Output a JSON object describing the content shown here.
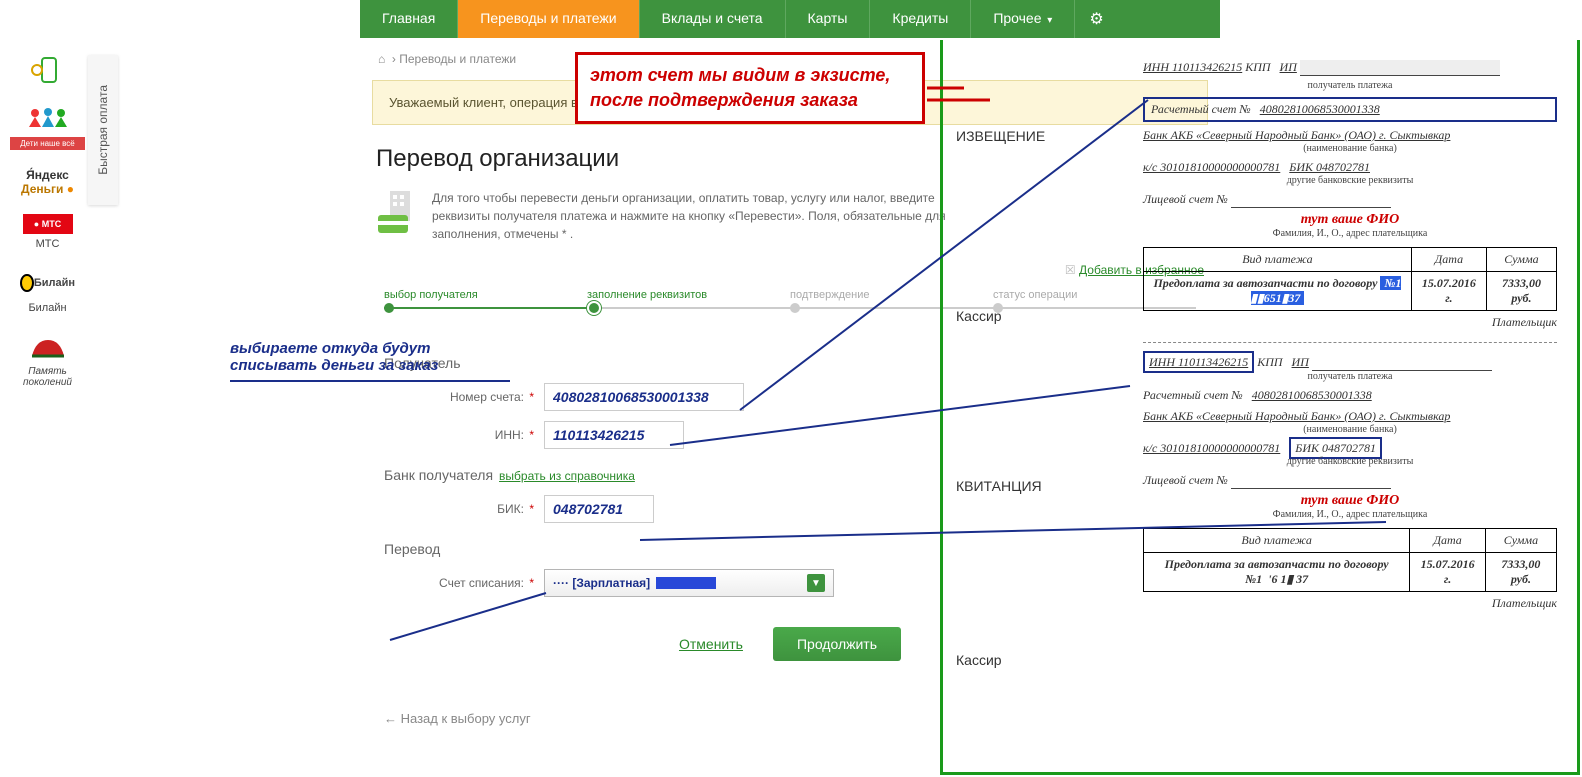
{
  "nav": {
    "items": [
      "Главная",
      "Переводы и платежи",
      "Вклады и счета",
      "Карты",
      "Кредиты",
      "Прочее"
    ],
    "active_index": 1
  },
  "sidebar": {
    "quick_pay": "Быстрая оплата",
    "items": [
      {
        "label": "",
        "icon": "phone"
      },
      {
        "label": "",
        "icon": "family"
      },
      {
        "label": "",
        "icon": "yandex",
        "text": "Я́ндекс\nДеньги"
      },
      {
        "label": "МТС",
        "icon": "mts"
      },
      {
        "label": "Билайн",
        "icon": "beeline"
      },
      {
        "label": "",
        "icon": "memory"
      }
    ]
  },
  "breadcrumb": {
    "home": "⌂",
    "path": "Переводы и платежи"
  },
  "alert": "Уважаемый клиент, операция возм",
  "title": "Перевод организации",
  "intro": "Для того чтобы перевести деньги организации, оплатить товар, услугу или налог, введите реквизиты получателя платежа и нажмите на кнопку «Перевести». Поля, обязательные для заполнения, отмечены * .",
  "favorites": "Добавить в избранное",
  "steps": [
    "выбор получателя",
    "заполнение реквизитов",
    "подтверждение",
    "статус операции"
  ],
  "form": {
    "section_recipient": "Получатель",
    "account_label": "Номер счета:",
    "account_value": "40802810068530001338",
    "inn_label": "ИНН:",
    "inn_value": "110113426215",
    "section_bank": "Банк получателя",
    "bank_sublink": "выбрать из справочника",
    "bik_label": "БИК:",
    "bik_value": "048702781",
    "section_transfer": "Перевод",
    "debit_label": "Счет списания:",
    "debit_value": "···· [Зарплатная]",
    "cancel": "Отменить",
    "continue": "Продолжить",
    "back": "← Назад к выбору услуг"
  },
  "annotations": {
    "red_box": "этот счет мы видим в экзисте, после подтверждения заказа",
    "blue_hint": "выбираете откуда будут списывать деньги за заказ"
  },
  "receipt": {
    "notice": "ИЗВЕЩЕНИЕ",
    "cashier": "Кассир",
    "slip": "КВИТАНЦИЯ",
    "inn": "ИНН 110113426215",
    "kpp": "КПП",
    "ip": "ИП",
    "acct_label": "Расчетный счет №",
    "acct_value": "40802810068530001338",
    "bank": "Банк АКБ «Северный Народный Банк» (ОАО) г. Сыктывкар",
    "bank_note": "(наименование банка)",
    "ks": "к/с 30101810000000000781",
    "bik": "БИК 048702781",
    "other": "другие банковские реквизиты",
    "pers_acct": "Лицевой счет №",
    "fio_note": "тут ваше ФИО",
    "fio_sub": "Фамилия, И., О., адрес плательщика",
    "recipient_note": "получатель платежа",
    "col_type": "Вид платежа",
    "col_date": "Дата",
    "col_sum": "Сумма",
    "pay_desc": "Предоплата за автозапчасти по договору",
    "contract1": "№1",
    "date": "15.07.2016 г.",
    "sum": "7333,00 руб.",
    "payer": "Плательщик"
  }
}
